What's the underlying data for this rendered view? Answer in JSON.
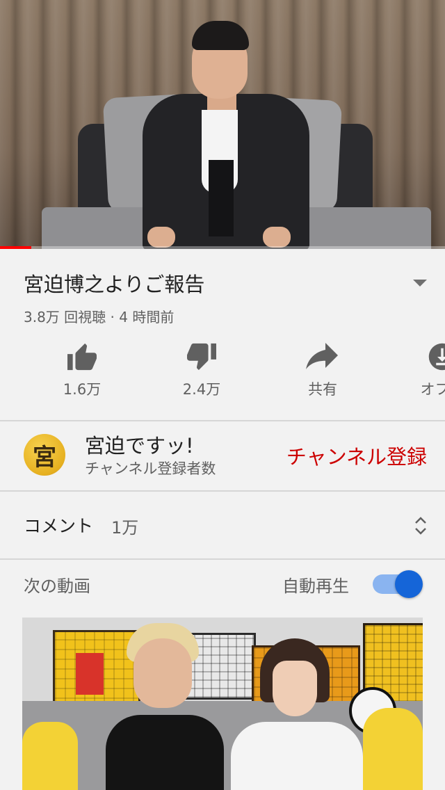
{
  "video": {
    "title": "宮迫博之よりご報告",
    "views": "3.8万 回視聴",
    "separator": "·",
    "time_ago": "4 時間前",
    "progress_fraction": 0.07
  },
  "actions": {
    "like": {
      "icon": "thumbs-up-icon",
      "label": "1.6万"
    },
    "dislike": {
      "icon": "thumbs-down-icon",
      "label": "2.4万"
    },
    "share": {
      "icon": "share-icon",
      "label": "共有"
    },
    "offline": {
      "icon": "download-icon",
      "label": "オフラ"
    }
  },
  "channel": {
    "avatar_text": "宮",
    "name": "宮迫ですッ!",
    "subscribers_label": "チャンネル登録者数",
    "subscribe_label": "チャンネル登録",
    "subscribe_color": "#cc0000"
  },
  "comments": {
    "label": "コメント",
    "count": "1万"
  },
  "up_next": {
    "label": "次の動画",
    "autoplay_label": "自動再生",
    "autoplay_on": true,
    "accent_color": "#1565d8"
  }
}
